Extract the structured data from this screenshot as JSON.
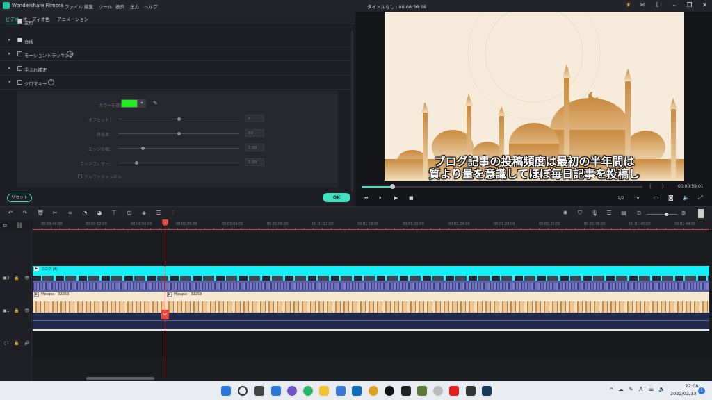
{
  "titlebar": {
    "app_name": "Wondershare Filmora",
    "menu": [
      "ファイル",
      "編集",
      "ツール",
      "表示",
      "出力",
      "ヘルプ"
    ],
    "project_title": "タイトルなし : 00:08:56:16"
  },
  "tabs": [
    "ビデオ",
    "オーディオ",
    "色",
    "アニメーション"
  ],
  "properties": {
    "rows": [
      {
        "label": "変形",
        "checked": true
      },
      {
        "label": "合成",
        "checked": true
      },
      {
        "label": "モーショントラッキング",
        "checked": false
      },
      {
        "label": "手ぶれ補正",
        "checked": false
      },
      {
        "label": "クロマキー",
        "checked": false
      }
    ],
    "chroma": {
      "color_label": "カラーを選択：",
      "color": "#22ee22",
      "sliders": [
        {
          "label": "オフセット：",
          "value": "0",
          "level": 0.5
        },
        {
          "label": "許容差：",
          "value": "50",
          "level": 0.5
        },
        {
          "label": "エッジの幅：",
          "value": "2.00",
          "level": 0.2
        },
        {
          "label": "エッジフェザー：",
          "value": "3.00",
          "level": 0.15
        }
      ],
      "alpha_label": "アルファチャンネル"
    },
    "reset_label": "リセット",
    "ok_label": "OK"
  },
  "preview": {
    "subtitle_line1": "ブログ記事の投稿頻度は最初の半年間は",
    "subtitle_line2": "質より量を意識してほぼ毎日記事を投稿し",
    "timecode": "00:00:59:01",
    "progress": 0.11,
    "ratio": "1/2"
  },
  "ruler": {
    "ticks": [
      "00:00:48:00",
      "00:00:52:00",
      "00:00:56:00",
      "00:01:00:00",
      "00:01:04:00",
      "00:01:08:00",
      "00:01:12:00",
      "00:01:16:00",
      "00:01:20:00",
      "00:01:24:00",
      "00:01:28:00",
      "00:01:32:00",
      "00:01:36:00",
      "00:01:40:00",
      "00:01:44:00"
    ]
  },
  "tracks": {
    "title_clip": "ブログ (4)",
    "video_clip_a": "Mosque - 32253",
    "video_clip_b": "Mosque - 32253",
    "accent_cyan": "#12f0f8",
    "audio_color": "#5b5fa8"
  },
  "taskbar": {
    "time": "22:08",
    "date": "2022/02/13",
    "badge": "1"
  }
}
